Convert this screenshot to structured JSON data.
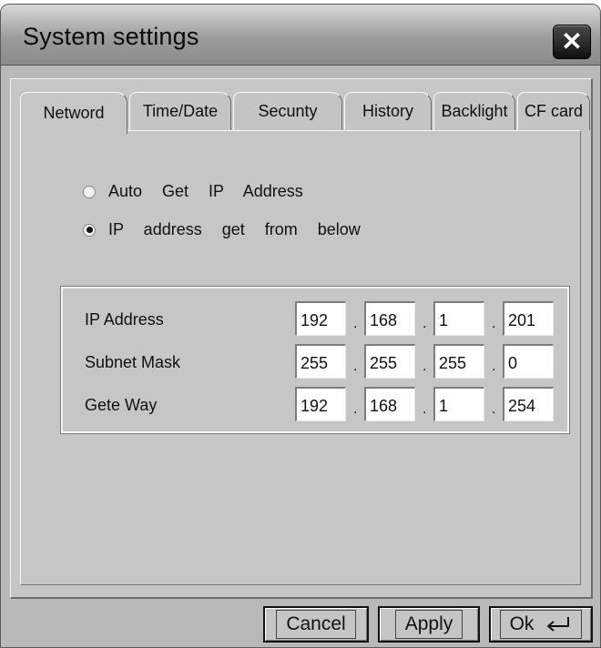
{
  "window": {
    "title": "System settings"
  },
  "tabs": [
    {
      "label": "Netword"
    },
    {
      "label": "Time/Date"
    },
    {
      "label": "Secunty"
    },
    {
      "label": "History"
    },
    {
      "label": "Backlight"
    },
    {
      "label": "CF card"
    }
  ],
  "network": {
    "options": [
      {
        "label": "Auto  Get  IP  Address",
        "selected": false
      },
      {
        "label": "IP  address  get  from  below",
        "selected": true
      }
    ],
    "fields": [
      {
        "label": "IP Address",
        "octets": [
          "192",
          "168",
          "1",
          "201"
        ]
      },
      {
        "label": "Subnet Mask",
        "octets": [
          "255",
          "255",
          "255",
          "0"
        ]
      },
      {
        "label": "Gete Way",
        "octets": [
          "192",
          "168",
          "1",
          "254"
        ]
      }
    ],
    "separator": "."
  },
  "footer": {
    "cancel_label": "Cancel",
    "apply_label": "Apply",
    "ok_label": "Ok"
  },
  "icons": {
    "close": "close-icon",
    "enter": "enter-icon"
  }
}
